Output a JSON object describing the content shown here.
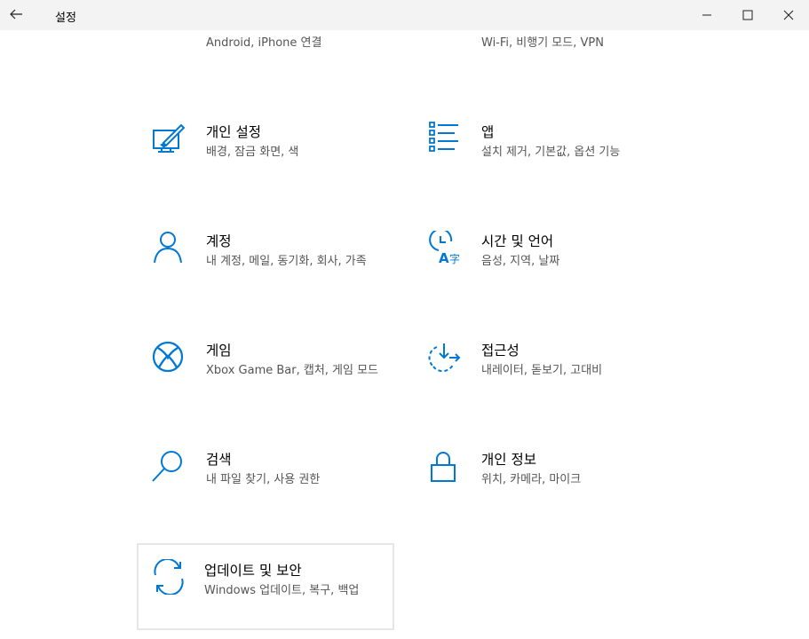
{
  "window": {
    "title": "설정",
    "back_icon": "back-arrow-icon",
    "minimize_icon": "minimize-icon",
    "maximize_icon": "maximize-icon",
    "close_icon": "close-icon"
  },
  "accent_color": "#0078d4",
  "tiles": [
    {
      "title": "",
      "desc": "Android, iPhone 연결",
      "icon": "phone-icon"
    },
    {
      "title": "",
      "desc": "Wi-Fi, 비행기 모드, VPN",
      "icon": "globe-icon"
    },
    {
      "title": "개인 설정",
      "desc": "배경, 잠금 화면, 색",
      "icon": "personalization-icon"
    },
    {
      "title": "앱",
      "desc": "설치 제거, 기본값, 옵션 기능",
      "icon": "apps-list-icon"
    },
    {
      "title": "계정",
      "desc": "내 계정, 메일, 동기화, 회사, 가족",
      "icon": "person-icon"
    },
    {
      "title": "시간 및 언어",
      "desc": "음성, 지역, 날짜",
      "icon": "time-language-icon"
    },
    {
      "title": "게임",
      "desc": "Xbox Game Bar, 캡처, 게임 모드",
      "icon": "xbox-icon"
    },
    {
      "title": "접근성",
      "desc": "내레이터, 돋보기, 고대비",
      "icon": "accessibility-icon"
    },
    {
      "title": "검색",
      "desc": "내 파일 찾기, 사용 권한",
      "icon": "search-icon"
    },
    {
      "title": "개인 정보",
      "desc": "위치, 카메라, 마이크",
      "icon": "lock-icon"
    },
    {
      "title": "업데이트 및 보안",
      "desc": "Windows 업데이트, 복구, 백업",
      "icon": "update-icon"
    }
  ]
}
